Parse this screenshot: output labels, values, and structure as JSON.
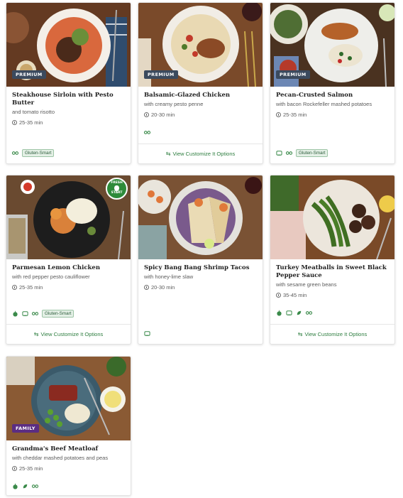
{
  "cards": [
    {
      "title": "Steakhouse Sirloin with Pesto Butter",
      "subtitle": "and tomato risotto",
      "time": "25-35 min",
      "badge": "PREMIUM",
      "tags": [
        "fork-knife-icon"
      ],
      "tag_label": "Gluten-Smart",
      "option_label": ""
    },
    {
      "title": "Balsamic-Glazed Chicken",
      "subtitle": "with creamy pesto penne",
      "time": "20-30 min",
      "badge": "PREMIUM",
      "tags": [
        "fork-knife-icon"
      ],
      "tag_label": "",
      "option_label": "View Customize It Options"
    },
    {
      "title": "Pecan-Crusted Salmon",
      "subtitle": "with bacon Rockefeller mashed potatoes",
      "time": "25-35 min",
      "badge": "PREMIUM",
      "tags": [
        "chef-hat-icon",
        "fork-knife-icon"
      ],
      "tag_label": "Gluten-Smart",
      "option_label": ""
    },
    {
      "title": "Parmesan Lemon Chicken",
      "subtitle": "with red pepper pesto cauliflower",
      "time": "25-35 min",
      "badge": "",
      "fresh_start_top": "FRESH",
      "fresh_start_bottom": "START",
      "tags": [
        "apple-icon",
        "chef-hat-icon",
        "fork-knife-icon"
      ],
      "tag_label": "Gluten-Smart",
      "option_label": "View Customize It Options"
    },
    {
      "title": "Spicy Bang Bang Shrimp Tacos",
      "subtitle": "with honey-lime slaw",
      "time": "20-30 min",
      "badge": "",
      "tags": [
        "chef-hat-icon"
      ],
      "tag_label": "",
      "option_label": ""
    },
    {
      "title": "Turkey Meatballs in Sweet Black Pepper Sauce",
      "subtitle": "with sesame green beans",
      "time": "35-45 min",
      "badge": "",
      "tags": [
        "apple-icon",
        "chef-hat-icon",
        "leaf-icon",
        "fork-knife-icon"
      ],
      "tag_label": "",
      "option_label": "View Customize It Options"
    },
    {
      "title": "Grandma's Beef Meatloaf",
      "subtitle": "with cheddar mashed potatoes and peas",
      "time": "25-35 min",
      "badge": "FAMILY",
      "tags": [
        "apple-icon",
        "leaf-icon",
        "fork-knife-icon"
      ],
      "tag_label": "",
      "option_label": ""
    }
  ],
  "colors": {
    "accent_green": "#2d7d3f",
    "premium_badge": "#3b4a5e",
    "family_badge": "#5b2d82"
  }
}
